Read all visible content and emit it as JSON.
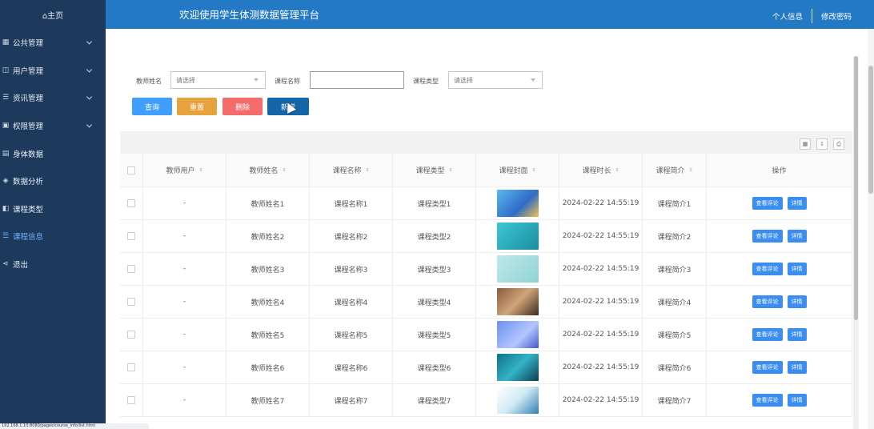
{
  "sidebar": {
    "home": "⌂主页",
    "items": [
      {
        "label": "公共管理",
        "icon": "grid-icon",
        "arrow": true
      },
      {
        "label": "用户管理",
        "icon": "user-icon",
        "arrow": true
      },
      {
        "label": "资讯管理",
        "icon": "list-icon",
        "arrow": true
      },
      {
        "label": "权限管理",
        "icon": "lock-icon",
        "arrow": true
      },
      {
        "label": "身体数据",
        "icon": "chart-icon",
        "arrow": false
      },
      {
        "label": "数据分析",
        "icon": "analysis-icon",
        "arrow": false
      },
      {
        "label": "课程类型",
        "icon": "tag-icon",
        "arrow": false
      },
      {
        "label": "课程信息",
        "icon": "list-icon",
        "arrow": false,
        "active": true
      },
      {
        "label": "退出",
        "icon": "share-icon",
        "arrow": false
      }
    ]
  },
  "header": {
    "title": "欢迎使用学生体测数据管理平台",
    "profile": "个人信息",
    "change_password": "修改密码"
  },
  "filters": {
    "teacher_label": "教师姓名",
    "teacher_placeholder": "请选择",
    "course_name_label": "课程名称",
    "course_name_value": "",
    "course_type_label": "课程类型",
    "course_type_placeholder": "请选择"
  },
  "buttons": {
    "query": "查询",
    "reset": "重置",
    "delete": "删除",
    "add": "新增"
  },
  "colors": {
    "sidebar": "#1d3a5c",
    "header": "#2479c5",
    "query": "#409eff",
    "reset": "#e6a23c",
    "delete": "#f56c6c",
    "add": "#1566a8",
    "action": "#3b8ef0"
  },
  "table": {
    "headers": [
      "教师用户",
      "教师姓名",
      "课程名称",
      "课程类型",
      "课程封面",
      "课程时长",
      "课程简介",
      "操作"
    ],
    "rows": [
      {
        "user": "-",
        "teacher": "教师姓名1",
        "name": "课程名称1",
        "type": "课程类型1",
        "duration": "2024-02-22 14:55:19",
        "intro": "课程简介1"
      },
      {
        "user": "-",
        "teacher": "教师姓名2",
        "name": "课程名称2",
        "type": "课程类型2",
        "duration": "2024-02-22 14:55:19",
        "intro": "课程简介2"
      },
      {
        "user": "-",
        "teacher": "教师姓名3",
        "name": "课程名称3",
        "type": "课程类型3",
        "duration": "2024-02-22 14:55:19",
        "intro": "课程简介3"
      },
      {
        "user": "-",
        "teacher": "教师姓名4",
        "name": "课程名称4",
        "type": "课程类型4",
        "duration": "2024-02-22 14:55:19",
        "intro": "课程简介4"
      },
      {
        "user": "-",
        "teacher": "教师姓名5",
        "name": "课程名称5",
        "type": "课程类型5",
        "duration": "2024-02-22 14:55:19",
        "intro": "课程简介5"
      },
      {
        "user": "-",
        "teacher": "教师姓名6",
        "name": "课程名称6",
        "type": "课程类型6",
        "duration": "2024-02-22 14:55:19",
        "intro": "课程简介6"
      },
      {
        "user": "-",
        "teacher": "教师姓名7",
        "name": "课程名称7",
        "type": "课程类型7",
        "duration": "2024-02-22 14:55:19",
        "intro": "课程简介7"
      }
    ],
    "view_comments": "查看评论",
    "detail": "详情"
  },
  "statusbar": {
    "url": "192.168.1.10:8080/pages/course_info/list.html"
  }
}
